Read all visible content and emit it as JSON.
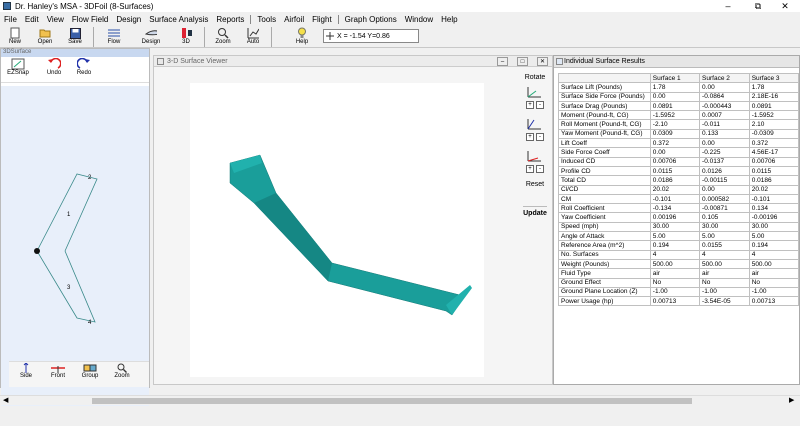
{
  "window": {
    "title": "Dr. Hanley's MSA - 3DFoil (8-Surfaces)"
  },
  "menu": [
    "File",
    "Edit",
    "View",
    "Flow Field",
    "Design",
    "Surface Analysis",
    "Reports",
    "Tools",
    "Airfoil",
    "Flight",
    "Graph Options",
    "Window",
    "Help"
  ],
  "toolbar": {
    "new": "New",
    "open": "Open",
    "save": "Save",
    "flow": "Flow",
    "design": "Design",
    "three_d": "3D",
    "zoom": "Zoom",
    "auto": "Auto",
    "help": "Help",
    "coords": "X = -1.54  Y=0.86"
  },
  "left_panel": {
    "header": "3DSurface",
    "ezsnap": "EZSnap",
    "undo": "Undo",
    "redo": "Redo",
    "nodes": [
      "2",
      "1",
      "3",
      "4"
    ],
    "bottom": {
      "side": "Side",
      "front": "Front",
      "group": "Group",
      "zoom": "Zoom"
    }
  },
  "viewer": {
    "title": "3-D Surface Viewer",
    "rotate": "Rotate",
    "reset": "Reset",
    "update": "Update",
    "shape_color": "#1a9e9a"
  },
  "results": {
    "title": "Individual Surface Results",
    "columns": [
      "",
      "Surface 1",
      "Surface 2",
      "Surface 3"
    ],
    "rows": [
      [
        "Surface Lift (Pounds)",
        "1.78",
        "0.00",
        "1.78"
      ],
      [
        "Surface Side Force (Pounds)",
        "0.00",
        "-0.0864",
        "2.18E-16"
      ],
      [
        "Surface Drag (Pounds)",
        "0.0891",
        "-0.000443",
        "0.0891"
      ],
      [
        "Moment (Pound-ft, CG)",
        "-1.5952",
        "0.0007",
        "-1.5952"
      ],
      [
        "Roll Moment (Pound-ft, CG)",
        "-2.10",
        "-0.011",
        "2.10"
      ],
      [
        "Yaw Moment (Pound-ft, CG)",
        "0.0309",
        "0.133",
        "-0.0309"
      ],
      [
        "Lift Coeff",
        "0.372",
        "0.00",
        "0.372"
      ],
      [
        "Side Force Coeff",
        "0.00",
        "-0.225",
        "4.56E-17"
      ],
      [
        "Induced CD",
        "0.00706",
        "-0.0137",
        "0.00706"
      ],
      [
        "Profile CD",
        "0.0115",
        "0.0126",
        "0.0115"
      ],
      [
        "Total CD",
        "0.0186",
        "-0.00115",
        "0.0186"
      ],
      [
        "Cl/CD",
        "20.02",
        "0.00",
        "20.02"
      ],
      [
        "CM",
        "-0.101",
        "0.000582",
        "-0.101"
      ],
      [
        "Roll Coefficient",
        "-0.134",
        "-0.00871",
        "0.134"
      ],
      [
        "Yaw Coefficient",
        "0.00196",
        "0.105",
        "-0.00196"
      ],
      [
        "Speed (mph)",
        "30.00",
        "30.00",
        "30.00"
      ],
      [
        "Angle of Attack",
        "5.00",
        "5.00",
        "5.00"
      ],
      [
        "Reference Area (m^2)",
        "0.194",
        "0.0155",
        "0.194"
      ],
      [
        "No. Surfaces",
        "4",
        "4",
        "4"
      ],
      [
        "Weight (Pounds)",
        "500.00",
        "500.00",
        "500.00"
      ],
      [
        "Fluid Type",
        "air",
        "air",
        "air"
      ],
      [
        "Ground Effect",
        "No",
        "No",
        "No"
      ],
      [
        "Ground Plane Location (Z)",
        "-1.00",
        "-1.00",
        "-1.00"
      ],
      [
        "Power Usage (hp)",
        "0.00713",
        "-3.54E-05",
        "0.00713"
      ]
    ]
  }
}
